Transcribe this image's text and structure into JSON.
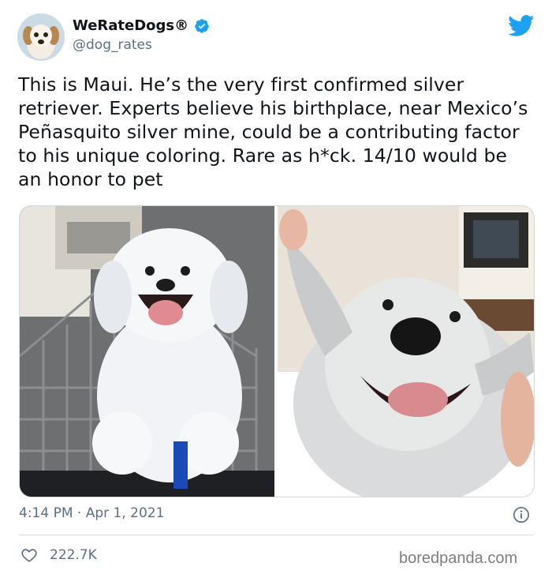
{
  "author": {
    "display_name": "WeRateDogs®",
    "handle": "@dog_rates",
    "avatar_icon": "dog-avatar",
    "verified": true
  },
  "tweet": {
    "text": "This is Maui. He’s the very first confirmed silver retriever. Experts believe his birthplace, near Mexico’s Peñasquito silver mine, could be a contributing factor to his unique coloring. Rare as h*ck. 14/10 would be an honor to pet",
    "time": "4:14 PM · Apr 1, 2021",
    "likes": "222.7K"
  },
  "media": {
    "photos": [
      "silver puppy in shopping cart",
      "silver dog smiling with ears held up"
    ]
  },
  "watermark": "boredpanda.com",
  "colors": {
    "twitter_blue": "#1da1f2",
    "secondary_text": "#5b7083",
    "divider": "#d6dde2"
  }
}
